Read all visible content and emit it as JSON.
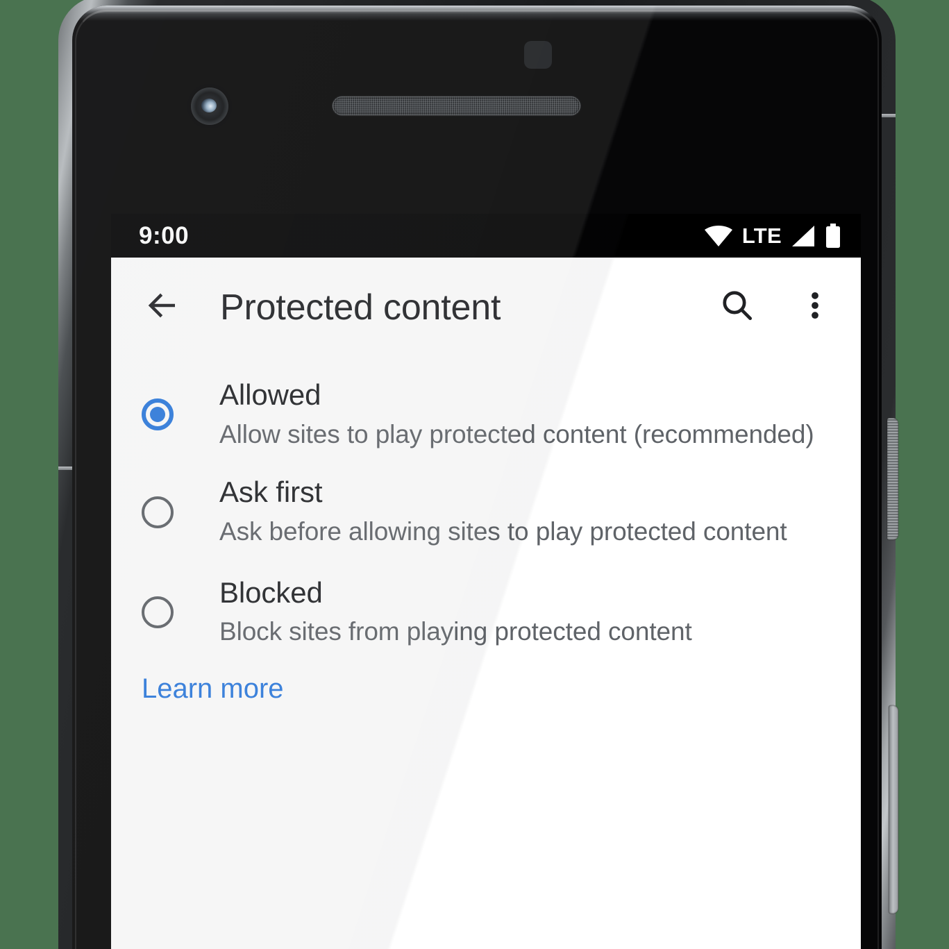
{
  "device": {
    "hardware": {
      "front_camera": "front-camera",
      "earpiece": "earpiece-speaker",
      "proximity_sensor": "proximity-sensor",
      "power_button": "power-button",
      "volume_button": "volume-rocker"
    }
  },
  "colors": {
    "background": "#4a7350",
    "accent_blue": "#2b7ae0",
    "title_text": "#202124",
    "secondary_text": "#5f6368",
    "status_bar": "#000000",
    "app_surface": "#ffffff"
  },
  "status_bar": {
    "time": "9:00",
    "network_label": "LTE",
    "icons": [
      "wifi-icon",
      "signal-icon",
      "battery-icon"
    ]
  },
  "app_bar": {
    "back_icon": "arrow-left-icon",
    "title": "Protected content",
    "search_icon": "search-icon",
    "overflow_icon": "more-vert-icon"
  },
  "options": [
    {
      "id": "allowed",
      "title": "Allowed",
      "description": "Allow sites to play protected content (recommended)",
      "selected": true
    },
    {
      "id": "ask-first",
      "title": "Ask first",
      "description": "Ask before allowing sites to play protected content",
      "selected": false
    },
    {
      "id": "blocked",
      "title": "Blocked",
      "description": "Block sites from playing protected content",
      "selected": false
    }
  ],
  "footer": {
    "learn_more_label": "Learn more"
  }
}
